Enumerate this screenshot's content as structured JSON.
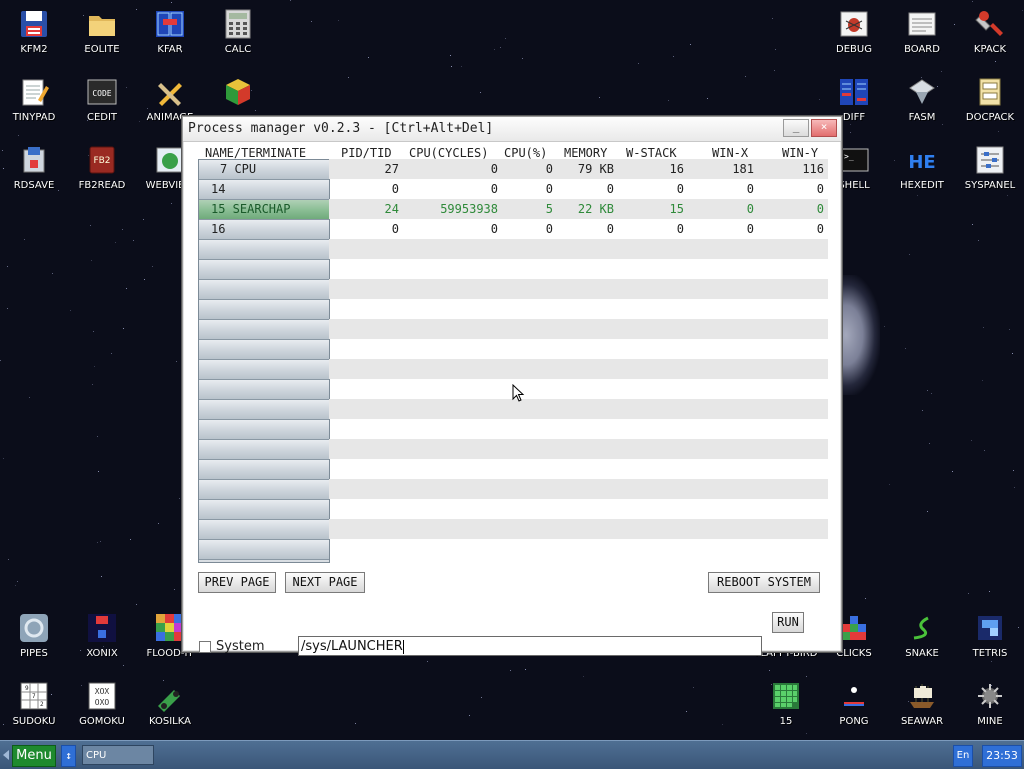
{
  "desktop_icons": [
    {
      "label": "KFM2",
      "icon": "floppy-disk-icon"
    },
    {
      "label": "EOLITE",
      "icon": "folder-icon"
    },
    {
      "label": "KFAR",
      "icon": "dual-panel-icon"
    },
    {
      "label": "CALC",
      "icon": "calculator-icon"
    },
    {
      "label": "TINYPAD",
      "icon": "notepad-icon"
    },
    {
      "label": "CEDIT",
      "icon": "code-editor-icon"
    },
    {
      "label": "ANIMAGE",
      "icon": "paint-tools-icon"
    },
    {
      "label": "",
      "icon": "rubik-cube-icon"
    },
    {
      "label": "RDSAVE",
      "icon": "disk-save-icon"
    },
    {
      "label": "FB2READ",
      "icon": "book-reader-icon"
    },
    {
      "label": "WEBVIEW",
      "icon": "web-browser-icon"
    },
    {
      "label": "DEBUG",
      "icon": "bug-icon"
    },
    {
      "label": "BOARD",
      "icon": "board-icon"
    },
    {
      "label": "KPACK",
      "icon": "packer-icon"
    },
    {
      "label": "DIFF",
      "icon": "diff-icon"
    },
    {
      "label": "FASM",
      "icon": "assembler-icon"
    },
    {
      "label": "DOCPACK",
      "icon": "docpack-icon"
    },
    {
      "label": "SHELL",
      "icon": "terminal-icon"
    },
    {
      "label": "HEXEDIT",
      "icon": "hex-editor-icon"
    },
    {
      "label": "SYSPANEL",
      "icon": "settings-sliders-icon"
    },
    {
      "label": "PIPES",
      "icon": "pipes-game-icon"
    },
    {
      "label": "XONIX",
      "icon": "xonix-game-icon"
    },
    {
      "label": "FLOOD-IT",
      "icon": "flood-it-game-icon"
    },
    {
      "label": "FLAPPY-BIRD",
      "icon": "flappy-bird-icon"
    },
    {
      "label": "CLICKS",
      "icon": "clicks-game-icon"
    },
    {
      "label": "SNAKE",
      "icon": "snake-game-icon"
    },
    {
      "label": "TETRIS",
      "icon": "tetris-game-icon"
    },
    {
      "label": "SUDOKU",
      "icon": "sudoku-game-icon"
    },
    {
      "label": "GOMOKU",
      "icon": "gomoku-game-icon"
    },
    {
      "label": "KOSILKA",
      "icon": "lawnmower-game-icon"
    },
    {
      "label": "15",
      "icon": "fifteen-puzzle-icon"
    },
    {
      "label": "PONG",
      "icon": "pong-game-icon"
    },
    {
      "label": "SEAWAR",
      "icon": "seawar-game-icon"
    },
    {
      "label": "MINE",
      "icon": "minesweeper-icon"
    }
  ],
  "window": {
    "title": "Process manager v0.2.3 - [Ctrl+Alt+Del]",
    "minimize_label": "_",
    "close_label": "×"
  },
  "table": {
    "headers": [
      "NAME/TERMINATE",
      "PID/TID",
      "CPU(CYCLES)",
      "CPU(%)",
      "MEMORY",
      "W-STACK",
      "WIN-X",
      "WIN-Y"
    ],
    "rows": [
      {
        "name": "7  CPU",
        "pid": "27",
        "cycles": "0",
        "cpu": "0",
        "memory": "79 KB",
        "wstack": "16",
        "winx": "181",
        "winy": "116"
      },
      {
        "name": "14",
        "pid": "0",
        "cycles": "0",
        "cpu": "0",
        "memory": "0",
        "wstack": "0",
        "winx": "0",
        "winy": "0"
      },
      {
        "name": "15  SEARCHAP",
        "pid": "24",
        "cycles": "59953938",
        "cpu": "5",
        "memory": "22 KB",
        "wstack": "15",
        "winx": "0",
        "winy": "0"
      },
      {
        "name": "16",
        "pid": "0",
        "cycles": "0",
        "cpu": "0",
        "memory": "0",
        "wstack": "0",
        "winx": "0",
        "winy": "0"
      }
    ],
    "selected_row": 2
  },
  "buttons": {
    "prev_page": "PREV PAGE",
    "next_page": "NEXT PAGE",
    "reboot": "REBOOT SYSTEM",
    "run": "RUN"
  },
  "system_checkbox": {
    "label": "System",
    "checked": false
  },
  "command_input": {
    "value": "/sys/LAUNCHER"
  },
  "taskbar": {
    "menu_label": "Menu",
    "switch_label": "↕",
    "task_item": "CPU",
    "language": "En",
    "clock": "23:53"
  },
  "colors": {
    "selected_row_text": "#2f8a3a",
    "menu_button": "#1e8a2e",
    "taskbar": "#3a5678",
    "close_button": "#e26d6d"
  }
}
